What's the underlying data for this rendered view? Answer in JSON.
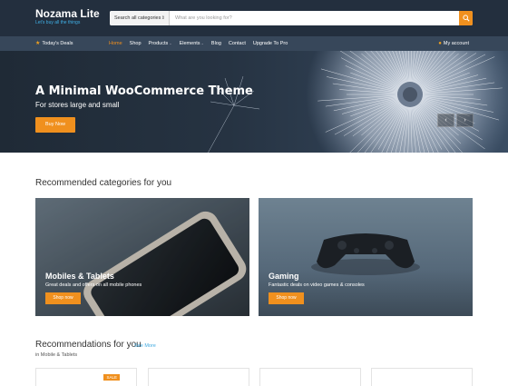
{
  "header": {
    "site_title": "Nozama Lite",
    "tagline": "Let's buy all the things",
    "search": {
      "category_label": "Search all categories",
      "placeholder": "What are you looking for?"
    }
  },
  "nav": {
    "deals_label": "Today's Deals",
    "items": [
      {
        "label": "Home",
        "active": true,
        "dropdown": false
      },
      {
        "label": "Shop",
        "active": false,
        "dropdown": false
      },
      {
        "label": "Products",
        "active": false,
        "dropdown": true
      },
      {
        "label": "Elements",
        "active": false,
        "dropdown": true
      },
      {
        "label": "Blog",
        "active": false,
        "dropdown": false
      },
      {
        "label": "Contact",
        "active": false,
        "dropdown": false
      },
      {
        "label": "Upgrade To Pro",
        "active": false,
        "dropdown": false
      }
    ],
    "account_label": "My account"
  },
  "hero": {
    "title": "A Minimal WooCommerce Theme",
    "subtitle": "For stores large and small",
    "button_label": "Buy Now",
    "prev_label": "‹",
    "next_label": "›"
  },
  "categories": {
    "section_title": "Recommended categories for you",
    "cards": [
      {
        "title": "Mobiles & Tablets",
        "description": "Great deals and offers on all mobile phones",
        "button_label": "Shop now"
      },
      {
        "title": "Gaming",
        "description": "Fantastic deals on video games & consoles",
        "button_label": "Shop now"
      }
    ]
  },
  "recommendations": {
    "section_title": "Recommendations for you",
    "see_more_label": "See More",
    "subtitle": "in Mobile & Tablets",
    "sale_badge": "SALE"
  },
  "colors": {
    "header_bg": "#232f3e",
    "nav_bg": "#37475a",
    "accent": "#f0901e",
    "link": "#3fa9e0"
  }
}
